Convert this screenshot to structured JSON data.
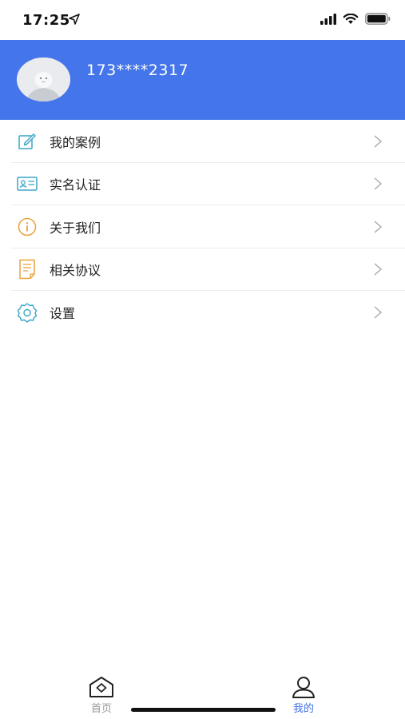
{
  "status_bar": {
    "time": "17:25"
  },
  "profile": {
    "phone": "173****2317"
  },
  "menu": {
    "items": [
      {
        "label": "我的案例",
        "icon": "edit-icon",
        "color": "#3BA6C9"
      },
      {
        "label": "实名认证",
        "icon": "id-card-icon",
        "color": "#3BA6C9"
      },
      {
        "label": "关于我们",
        "icon": "info-icon",
        "color": "#E9A23B"
      },
      {
        "label": "相关协议",
        "icon": "document-icon",
        "color": "#E9A23B"
      },
      {
        "label": "设置",
        "icon": "gear-icon",
        "color": "#3BA6C9"
      }
    ]
  },
  "tabbar": {
    "home_label": "首页",
    "mine_label": "我的"
  },
  "colors": {
    "header_bg": "#4475EA",
    "tab_active": "#3F6FE0",
    "tab_inactive": "#999999"
  }
}
